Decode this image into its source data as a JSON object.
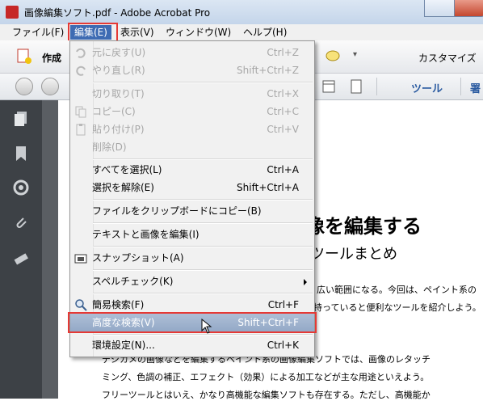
{
  "window": {
    "title": "画像編集ソフト.pdf - Adobe Acrobat Pro"
  },
  "menubar": {
    "items": [
      {
        "label": "ファイル(F)"
      },
      {
        "label": "編集(E)"
      },
      {
        "label": "表示(V)"
      },
      {
        "label": "ウィンドウ(W)"
      },
      {
        "label": "ヘルプ(H)"
      }
    ]
  },
  "toolbar": {
    "create_label": "作成",
    "customize_label": "カスタマイズ",
    "tools_label": "ツール",
    "comment_label_partial": "署"
  },
  "edit_menu": {
    "items": [
      {
        "label": "元に戻す(U)",
        "shortcut": "Ctrl+Z",
        "enabled": false,
        "icon": "undo-icon"
      },
      {
        "label": "やり直し(R)",
        "shortcut": "Shift+Ctrl+Z",
        "enabled": false,
        "icon": "redo-icon"
      },
      {
        "label": "切り取り(T)",
        "shortcut": "Ctrl+X",
        "enabled": false
      },
      {
        "label": "コピー(C)",
        "shortcut": "Ctrl+C",
        "enabled": false,
        "icon": "copy-icon"
      },
      {
        "label": "貼り付け(P)",
        "shortcut": "Ctrl+V",
        "enabled": false,
        "icon": "paste-icon"
      },
      {
        "label": "削除(D)",
        "shortcut": "",
        "enabled": false
      },
      {
        "label": "すべてを選択(L)",
        "shortcut": "Ctrl+A",
        "enabled": true
      },
      {
        "label": "選択を解除(E)",
        "shortcut": "Shift+Ctrl+A",
        "enabled": true
      },
      {
        "label": "ファイルをクリップボードにコピー(B)",
        "shortcut": "",
        "enabled": true
      },
      {
        "label": "テキストと画像を編集(I)",
        "shortcut": "",
        "enabled": true
      },
      {
        "label": "スナップショット(A)",
        "shortcut": "",
        "enabled": true,
        "icon": "camera-icon"
      },
      {
        "label": "スペルチェック(K)",
        "shortcut": "",
        "enabled": true,
        "submenu": true
      },
      {
        "label": "簡易検索(F)",
        "shortcut": "Ctrl+F",
        "enabled": true,
        "icon": "search-icon"
      },
      {
        "label": "高度な検索(V)",
        "shortcut": "Shift+Ctrl+F",
        "enabled": true,
        "highlighted": true
      },
      {
        "label": "環境設定(N)...",
        "shortcut": "Ctrl+K",
        "enabled": true
      }
    ]
  },
  "document": {
    "heading_partial": "像を編集する",
    "subheading_partial": "ツールまとめ",
    "lines": [
      "広い範囲になる。今回は、ペイント系の",
      "持っていると便利なツールを紹介しよう。",
      "デジカメの画像などを編集するペイント系の画像編集ソフトでは、画像のレタッチ",
      "ミング、色調の補正、エフェクト（効果）による加工などが主な用途といえよう。",
      "フリーツールとはいえ、かなり高機能な編集ソフトも存在する。ただし、高機能か"
    ]
  },
  "colors": {
    "menu_active": "#3e6bb3",
    "highlight_box": "#e53935",
    "menu_hover": "#9fb3cf"
  }
}
